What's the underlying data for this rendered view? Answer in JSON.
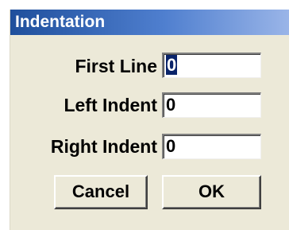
{
  "dialog": {
    "title": "Indentation"
  },
  "fields": {
    "first_line": {
      "label": "First Line",
      "value": "0"
    },
    "left_indent": {
      "label": "Left Indent",
      "value": "0"
    },
    "right_indent": {
      "label": "Right Indent",
      "value": "0"
    }
  },
  "buttons": {
    "cancel_label": "Cancel",
    "ok_label": "OK"
  },
  "colors": {
    "title_bar_start": "#1f4f9c",
    "title_bar_end": "#9ab5e8",
    "dialog_background": "#ece9d8",
    "selection_highlight": "#0a246a"
  }
}
